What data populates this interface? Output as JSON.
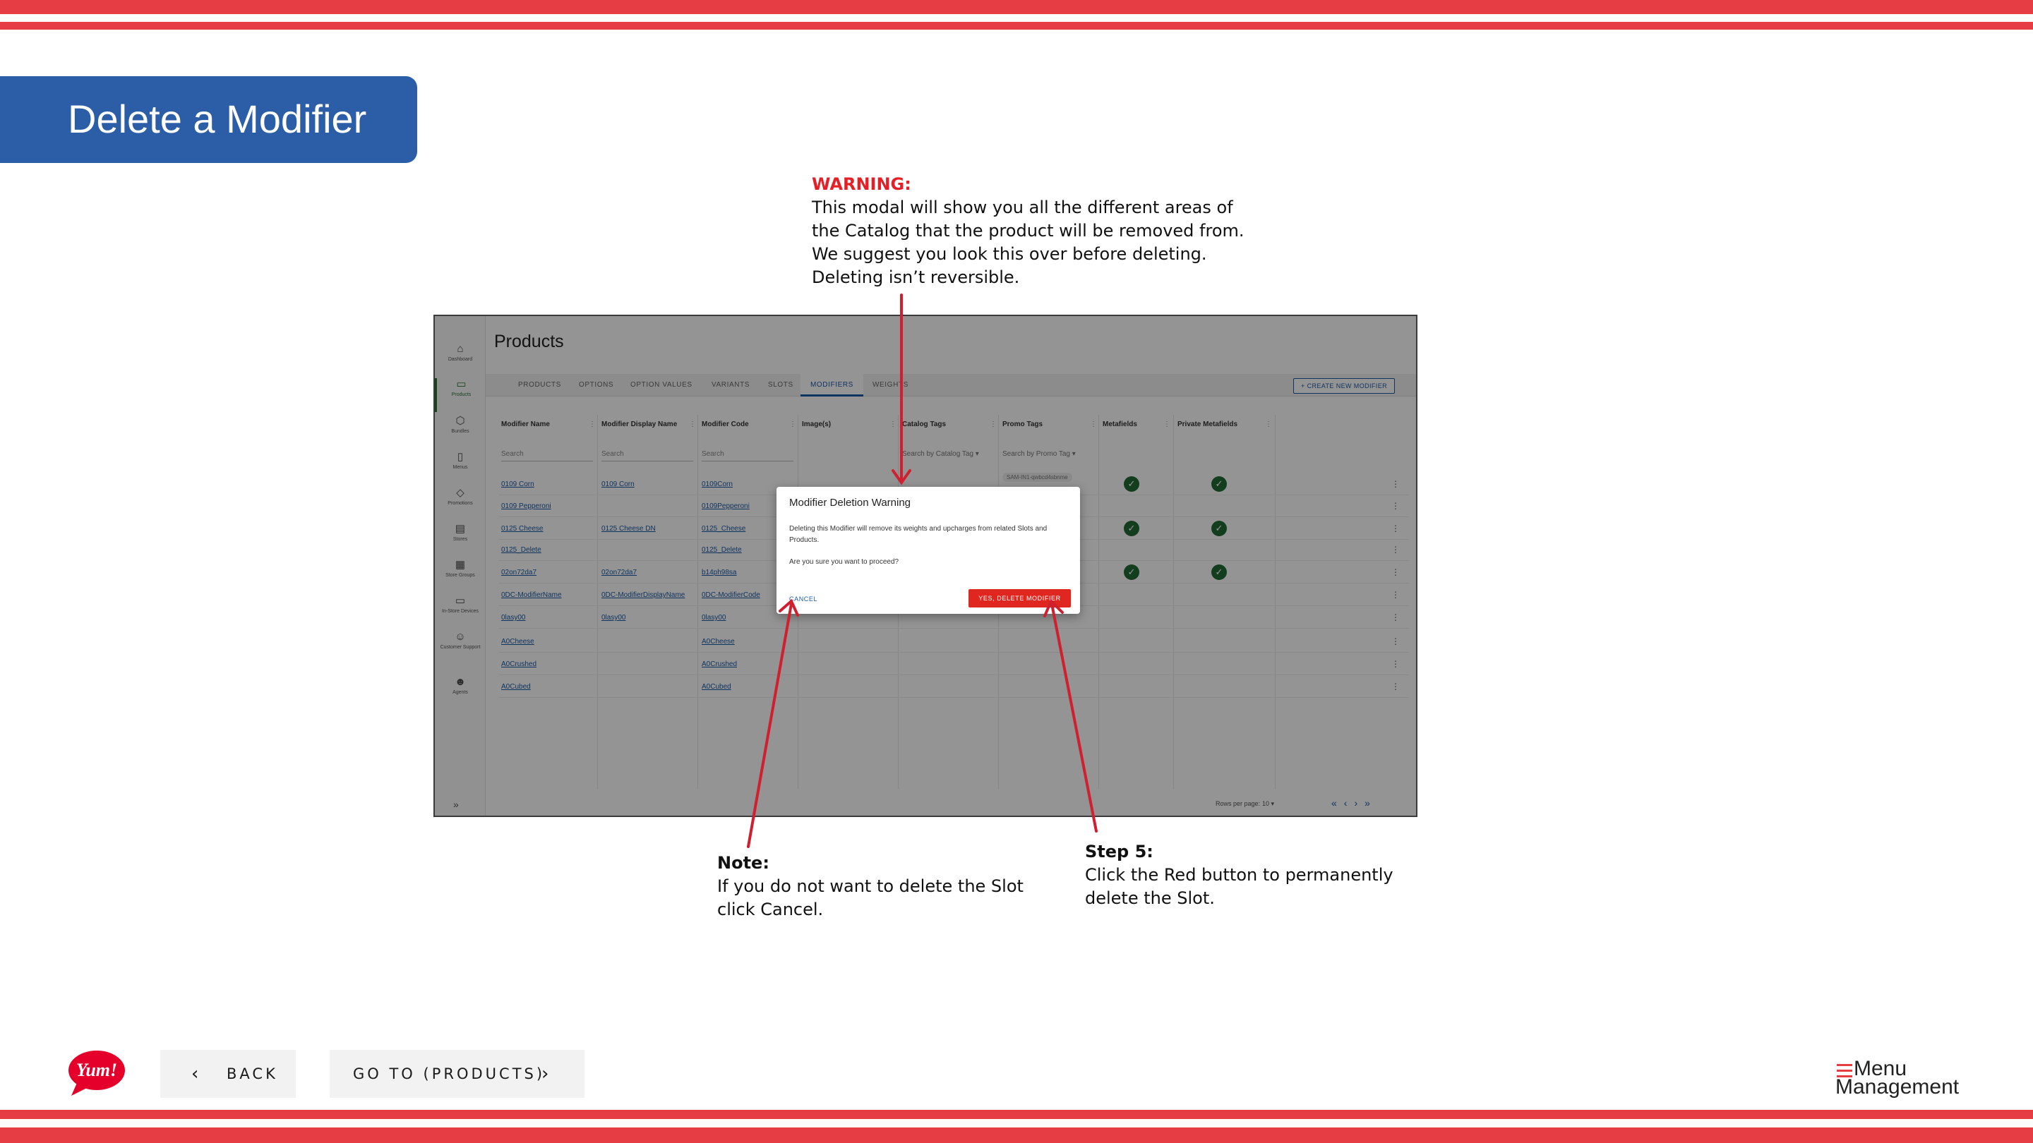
{
  "slide": {
    "title": "Delete a Modifier"
  },
  "annotations": {
    "warning": {
      "head": "WARNING:",
      "lines": [
        "This modal will show you all the different areas of",
        "the Catalog that the product will be removed from.",
        "We suggest you look this over before deleting.",
        "Deleting isn’t reversible."
      ]
    },
    "note": {
      "head": "Note:",
      "lines": [
        "If you do not want to delete the Slot",
        "click Cancel."
      ]
    },
    "step5": {
      "head": "Step 5:",
      "lines": [
        "Click the Red button to permanently",
        "delete the Slot."
      ]
    }
  },
  "app": {
    "page_title": "Products",
    "sidebar": [
      {
        "label": "Dashboard",
        "icon": "home-icon"
      },
      {
        "label": "Products",
        "icon": "box-icon"
      },
      {
        "label": "Bundles",
        "icon": "cube-icon"
      },
      {
        "label": "Menus",
        "icon": "document-icon"
      },
      {
        "label": "Promotions",
        "icon": "tag-icon"
      },
      {
        "label": "Stores",
        "icon": "store-icon"
      },
      {
        "label": "Store Groups",
        "icon": "grid-icon"
      },
      {
        "label": "In-Store Devices",
        "icon": "monitor-icon"
      },
      {
        "label": "Customer Support",
        "icon": "person-icon"
      },
      {
        "label": "Agents",
        "icon": "people-icon"
      }
    ],
    "tabs": [
      "PRODUCTS",
      "OPTIONS",
      "OPTION VALUES",
      "VARIANTS",
      "SLOTS",
      "MODIFIERS",
      "WEIGHTS"
    ],
    "active_tab": "MODIFIERS",
    "create_button": "CREATE NEW MODIFIER",
    "columns": [
      "Modifier Name",
      "Modifier Display Name",
      "Modifier Code",
      "Image(s)",
      "Catalog Tags",
      "Promo Tags",
      "Metafields",
      "Private Metafields"
    ],
    "search_placeholders": {
      "name": "Search",
      "display": "Search",
      "code": "Search",
      "catalog": "Search by Catalog Tag",
      "promo": "Search by Promo Tag"
    },
    "promo_chip": "SAM-IN1-qwbcd4sbnme",
    "rows": [
      {
        "name": "0109 Corn",
        "display": "0109 Corn",
        "code": "0109Corn",
        "meta": true,
        "private": true
      },
      {
        "name": "0109 Pepperoni",
        "display": "",
        "code": "0109Pepperoni",
        "meta": false,
        "private": false
      },
      {
        "name": "0125 Cheese",
        "display": "0125 Cheese DN",
        "code": "0125_Cheese",
        "meta": true,
        "private": true
      },
      {
        "name": "0125_Delete",
        "display": "",
        "code": "0125_Delete",
        "meta": false,
        "private": false
      },
      {
        "name": "02on72da7",
        "display": "02on72da7",
        "code": "b14ph98sa",
        "meta": true,
        "private": true
      },
      {
        "name": "0DC-ModifierName",
        "display": "0DC-ModifierDisplayName",
        "code": "0DC-ModifierCode",
        "meta": false,
        "private": false
      },
      {
        "name": "0lasy00",
        "display": "0lasy00",
        "code": "0lasy00",
        "meta": false,
        "private": false
      },
      {
        "name": "A0Cheese",
        "display": "",
        "code": "A0Cheese",
        "meta": false,
        "private": false
      },
      {
        "name": "A0Crushed",
        "display": "",
        "code": "A0Crushed",
        "meta": false,
        "private": false
      },
      {
        "name": "A0Cubed",
        "display": "",
        "code": "A0Cubed",
        "meta": false,
        "private": false
      }
    ],
    "pager": {
      "label": "Rows per page:",
      "value": "10"
    },
    "modal": {
      "title": "Modifier Deletion Warning",
      "body": "Deleting this Modifier will remove its weights and upcharges from related Slots and Products.",
      "question": "Are you sure you want to proceed?",
      "cancel": "CANCEL",
      "confirm": "YES, DELETE MODIFIER"
    }
  },
  "nav": {
    "back": "BACK",
    "goto": "GO TO (PRODUCTS)"
  },
  "logos": {
    "yum": "Yum!",
    "menu_line1": "Menu",
    "menu_line2": "Management"
  },
  "colors": {
    "stripe": "#e63c43",
    "title_bg": "#2c5ea8",
    "warning_text": "#e61e26",
    "arrow": "#d0202f",
    "delete_button": "#e0271f"
  }
}
